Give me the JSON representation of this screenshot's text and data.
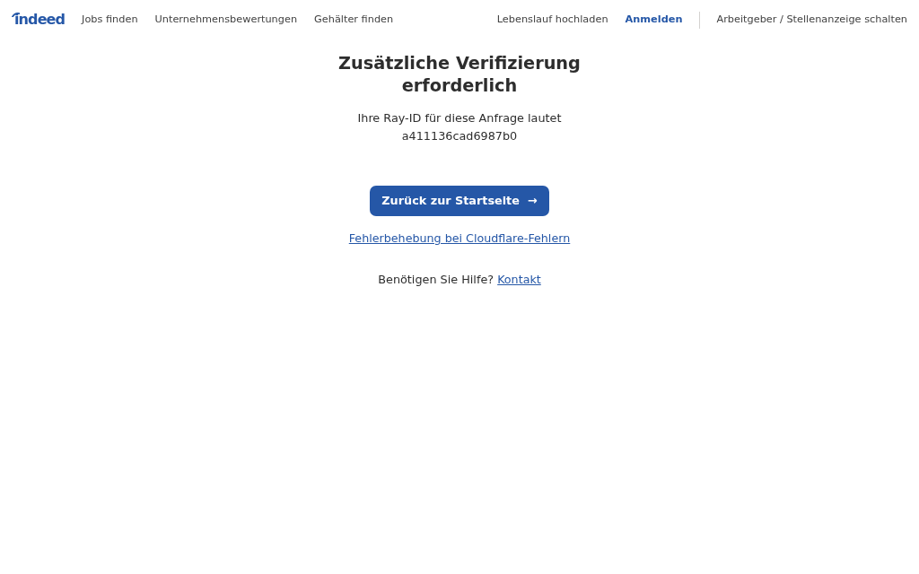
{
  "header": {
    "logo": "indeed",
    "nav_left": [
      "Jobs finden",
      "Unternehmensbewertungen",
      "Gehälter finden"
    ],
    "nav_right": [
      "Lebenslauf hochladen"
    ],
    "sign_in": "Anmelden",
    "employer_link": "Arbeitgeber / Stellenanzeige schalten"
  },
  "main": {
    "title": "Zusätzliche Verifizierung erforderlich",
    "ray_text": "Ihre Ray-ID für diese Anfrage lautet",
    "ray_id": "a411136cad6987b0",
    "button": {
      "label": "Zurück zur Startseite",
      "arrow": "→"
    },
    "troubleshoot_link": "Fehlerbehebung bei Cloudflare-Fehlern",
    "help": {
      "text": "Benötigen Sie Hilfe?",
      "link": "Kontakt"
    }
  }
}
